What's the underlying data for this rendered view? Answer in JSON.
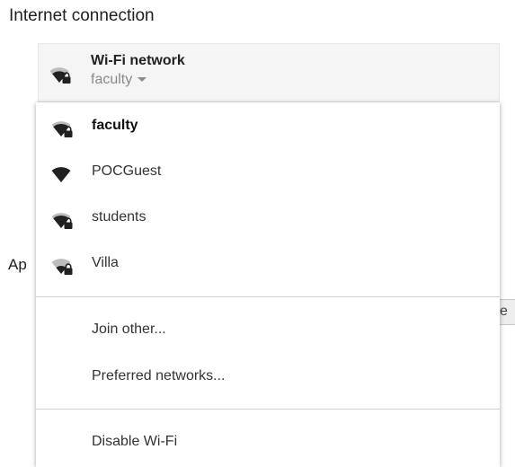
{
  "section": {
    "title": "Internet connection"
  },
  "background": {
    "partial_label": "Ap",
    "partial_button": "e"
  },
  "network_selector": {
    "title": "Wi-Fi network",
    "current": "faculty",
    "icon": "wifi-lock-icon"
  },
  "menu": {
    "networks": [
      {
        "name": "faculty",
        "secured": true,
        "selected": true,
        "icon": "wifi-lock-icon"
      },
      {
        "name": "POCGuest",
        "secured": false,
        "selected": false,
        "icon": "wifi-icon"
      },
      {
        "name": "students",
        "secured": true,
        "selected": false,
        "icon": "wifi-lock-icon"
      },
      {
        "name": "Villa",
        "secured": true,
        "selected": false,
        "icon": "wifi-lock-icon"
      }
    ],
    "actions": [
      {
        "label": "Join other..."
      },
      {
        "label": "Preferred networks..."
      }
    ],
    "disable": {
      "label": "Disable Wi-Fi"
    }
  },
  "colors": {
    "icon_full": "#212121",
    "icon_dim": "#bdbdbd",
    "separator": "#d0d0d0"
  }
}
